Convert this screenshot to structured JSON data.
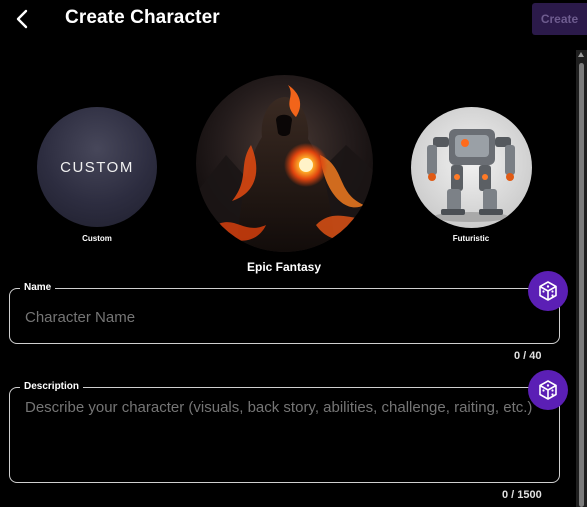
{
  "header": {
    "title": "Create Character",
    "create_label": "Create"
  },
  "genres": [
    {
      "label": "Custom",
      "circle_text": "CUSTOM"
    },
    {
      "label": "Epic Fantasy"
    },
    {
      "label": "Futuristic"
    }
  ],
  "name_field": {
    "legend": "Name",
    "placeholder": "Character Name",
    "value": "",
    "counter": "0 / 40"
  },
  "description_field": {
    "legend": "Description",
    "placeholder": "Describe your character (visuals, back story, abilities, challenge, raiting, etc.)",
    "value": "",
    "counter": "0 / 1500"
  },
  "colors": {
    "accent": "#5b1fb5",
    "create_button_bg": "#2b1a4a",
    "background": "#000000"
  },
  "icons": {
    "back": "chevron-left-icon",
    "randomize": "dice-icon"
  }
}
